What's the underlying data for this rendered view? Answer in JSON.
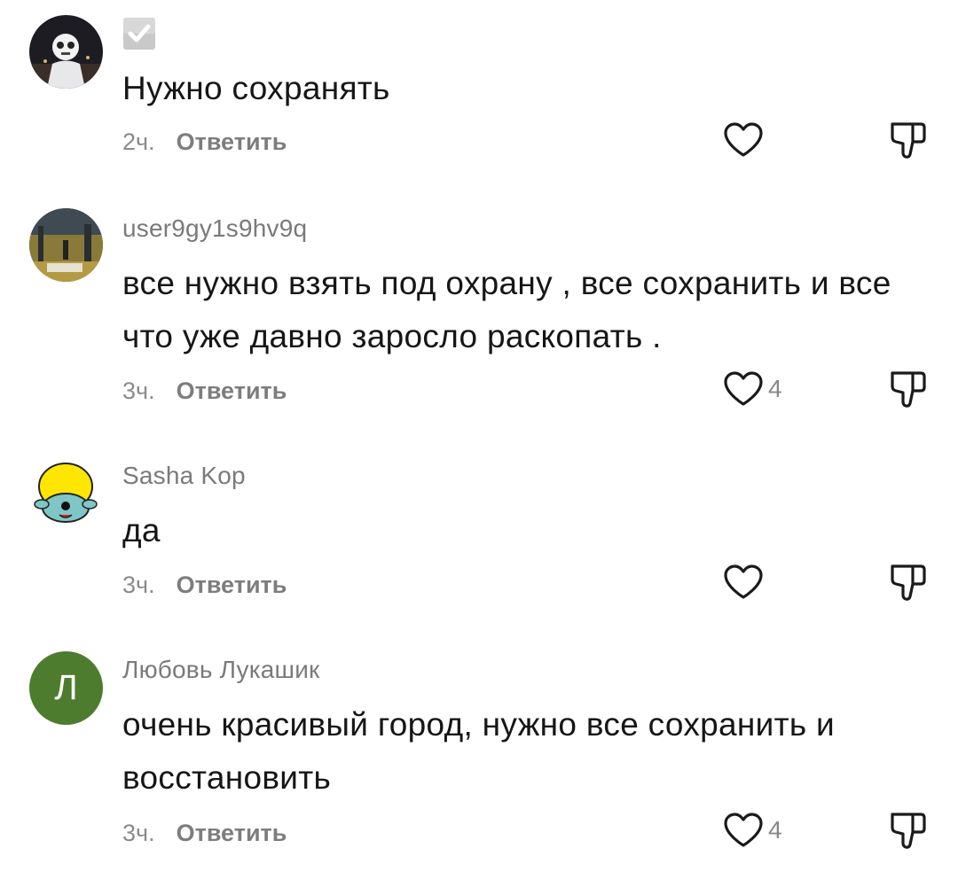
{
  "comments": [
    {
      "username": "",
      "verified": true,
      "text": "Нужно сохранять",
      "time": "2ч.",
      "reply_label": "Ответить",
      "likes": ""
    },
    {
      "username": "user9gy1s9hv9q",
      "text": "все нужно взять под охрану , все сохранить и все что уже давно заросло раскопать .",
      "time": "3ч.",
      "reply_label": "Ответить",
      "likes": "4"
    },
    {
      "username": "Sasha Kop",
      "text": "да",
      "time": "3ч.",
      "reply_label": "Ответить",
      "likes": ""
    },
    {
      "username": "Любовь Лукашик",
      "avatar_letter": "Л",
      "avatar_color": "#4e7c2e",
      "text": "очень красивый город, нужно все сохранить и восстановить",
      "time": "3ч.",
      "reply_label": "Ответить",
      "likes": "4"
    }
  ]
}
